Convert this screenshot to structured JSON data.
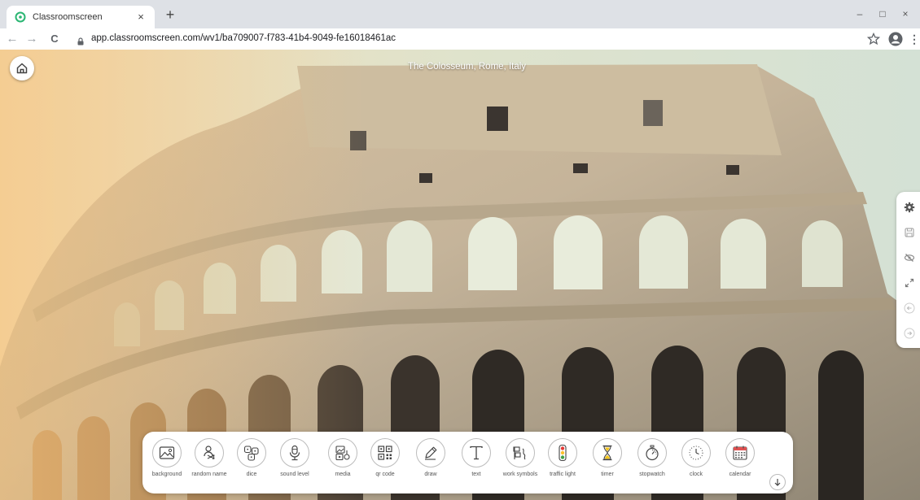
{
  "browser": {
    "tab_title": "Classroomscreen",
    "tab_close": "×",
    "new_tab": "+",
    "url": "app.classroomscreen.com/wv1/ba709007-f783-41b4-9049-fe16018461ac",
    "window_controls": [
      "–",
      "□",
      "×"
    ],
    "back": "←",
    "forward": "→",
    "reload": "C",
    "more": "⋮"
  },
  "page": {
    "caption": "The Colosseum, Rome, Italy"
  },
  "side_panel": {
    "icons": [
      "gear-icon",
      "save-icon",
      "eye-off-icon",
      "fullscreen-icon",
      "arrow-left-icon",
      "arrow-right-icon"
    ]
  },
  "widgets": [
    {
      "label": "background",
      "icon": "image-icon"
    },
    {
      "label": "random name",
      "icon": "random-name-icon"
    },
    {
      "label": "dice",
      "icon": "dice-icon"
    },
    {
      "label": "sound level",
      "icon": "microphone-icon"
    },
    {
      "label": "media",
      "icon": "media-icon"
    },
    {
      "label": "qr code",
      "icon": "qr-code-icon"
    },
    {
      "label": "draw",
      "icon": "pencil-icon"
    },
    {
      "label": "text",
      "icon": "text-icon"
    },
    {
      "label": "work symbols",
      "icon": "work-symbols-icon"
    },
    {
      "label": "traffic light",
      "icon": "traffic-light-icon"
    },
    {
      "label": "timer",
      "icon": "hourglass-icon"
    },
    {
      "label": "stopwatch",
      "icon": "stopwatch-icon"
    },
    {
      "label": "clock",
      "icon": "clock-icon"
    },
    {
      "label": "calendar",
      "icon": "calendar-icon"
    }
  ],
  "colors": {
    "accent_green": "#2bb673",
    "traffic_red": "#e53935",
    "traffic_yellow": "#fbc02d",
    "traffic_green": "#43a047",
    "timer_yellow": "#f5c518",
    "calendar_red": "#e05252"
  }
}
